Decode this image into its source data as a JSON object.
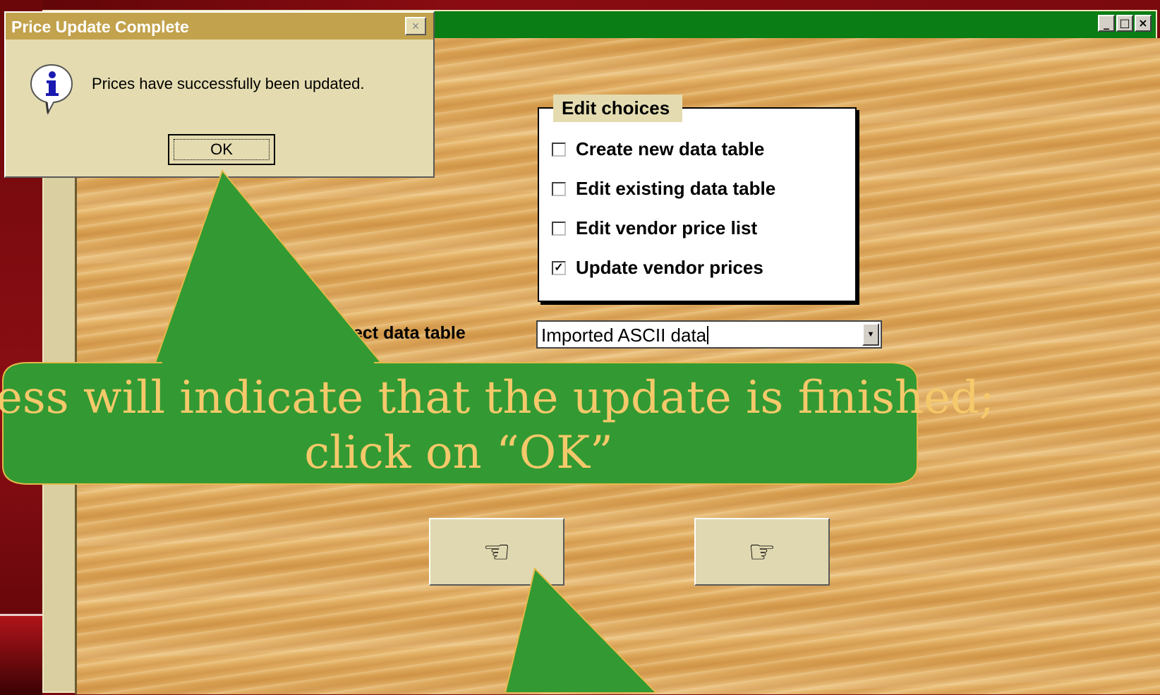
{
  "dialog": {
    "title": "Price Update Complete",
    "close_glyph": "×",
    "message": "Prices have successfully been updated.",
    "ok_label": "OK",
    "icon": "info-icon"
  },
  "window": {
    "controls": [
      "_",
      "□",
      "×"
    ]
  },
  "edit_choices": {
    "group_label": "Edit choices",
    "options": [
      {
        "label": "Create new data table",
        "checked": false
      },
      {
        "label": "Edit existing data table",
        "checked": false
      },
      {
        "label": "Edit vendor price list",
        "checked": false
      },
      {
        "label": "Update vendor prices",
        "checked": true
      }
    ]
  },
  "data_table": {
    "label": "ect data table",
    "value": "Imported ASCII data"
  },
  "nav": {
    "back_glyph": "☜",
    "forward_glyph": "☞"
  },
  "callout": {
    "line1": "ess will indicate that the update is finished;",
    "line2": "click on “OK”",
    "fill_color": "#339933",
    "text_color": "#f5c96a"
  }
}
